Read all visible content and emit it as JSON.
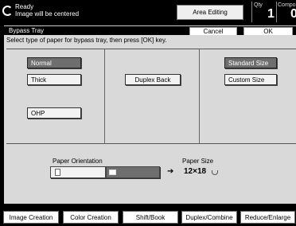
{
  "status": {
    "line1": "Ready",
    "line2": "Image will be centered",
    "area_button": "Area Editing",
    "quantity_label": "Qty",
    "quantity_value": "1",
    "composite_label": "Compo",
    "composite_value": "0"
  },
  "dialog": {
    "title": "Bypass Tray",
    "cancel_label": "Cancel",
    "ok_label": "OK",
    "instruction": "Select type of paper for bypass tray, then press [OK] key."
  },
  "paper_type": {
    "normal": "Normal",
    "thick": "Thick",
    "ohp": "OHP",
    "selected": "Normal"
  },
  "duplex": {
    "label": "Duplex Back"
  },
  "size_mode": {
    "standard": "Standard Size",
    "custom": "Custom Size",
    "selected": "Standard Size"
  },
  "orientation": {
    "label": "Paper Orientation",
    "selected": "landscape"
  },
  "paper_size": {
    "label": "Paper Size",
    "value": "12×18"
  },
  "bottom_tabs": [
    {
      "label": "Image Creation"
    },
    {
      "label": "Color Creation"
    },
    {
      "label": "Shift/Book"
    },
    {
      "label": "Duplex/Combine"
    },
    {
      "label": "Reduce/Enlarge"
    }
  ]
}
